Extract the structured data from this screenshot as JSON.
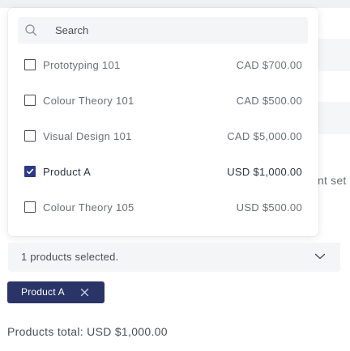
{
  "search": {
    "placeholder": "Search",
    "value": ""
  },
  "options": [
    {
      "label": "Prototyping 101",
      "price": "CAD $700.00",
      "checked": false
    },
    {
      "label": "Colour Theory 101",
      "price": "CAD $500.00",
      "checked": false
    },
    {
      "label": "Visual Design 101",
      "price": "CAD $5,000.00",
      "checked": false
    },
    {
      "label": "Product A",
      "price": "USD $1,000.00",
      "checked": true
    },
    {
      "label": "Colour Theory 105",
      "price": "USD $500.00",
      "checked": false
    }
  ],
  "select": {
    "summary": "1 products selected."
  },
  "chips": [
    {
      "label": "Product A"
    }
  ],
  "footer": {
    "total": "Products total: USD $1,000.00"
  },
  "background": {
    "partial_text": "nt set"
  },
  "colors": {
    "accent": "#2b3467",
    "checkbox_checked": "#2b3a86",
    "field_bg": "#f4f5f7"
  },
  "icons": {
    "search": "search-icon",
    "chevron": "chevron-down-icon",
    "chip_close": "close-icon",
    "check": "check-icon"
  }
}
